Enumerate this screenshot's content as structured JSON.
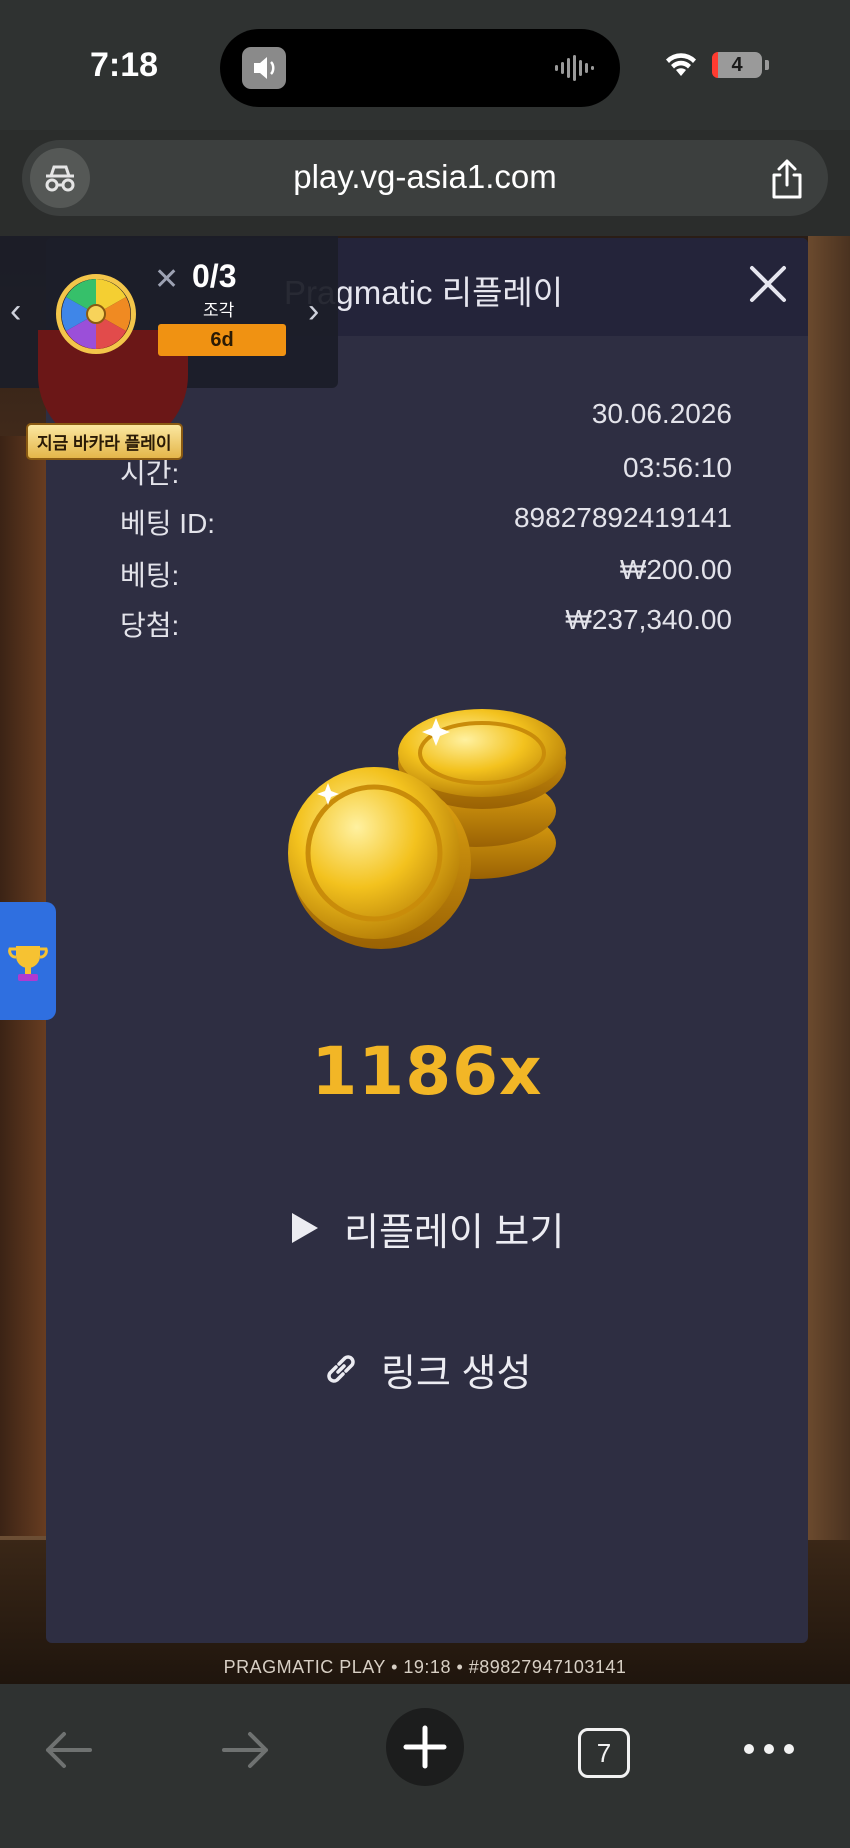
{
  "status_bar": {
    "time": "7:18",
    "battery": "4"
  },
  "browser": {
    "url": "play.vg-asia1.com",
    "tab_count": "7"
  },
  "promo": {
    "count": "0/3",
    "unit": "조각",
    "days_badge": "6d",
    "cta": "지금 바카라 플레이"
  },
  "modal": {
    "title": "Pragmatic 리플레이",
    "date_value": "30.06.2026",
    "time_label": "시간:",
    "time_value": "03:56:10",
    "bet_id_label": "베팅 ID:",
    "bet_id_value": "89827892419141",
    "bet_label": "베팅:",
    "bet_value": "₩200.00",
    "win_label": "당첨:",
    "win_value": "₩237,340.00",
    "multiplier": "1186x",
    "replay_label": "리플레이 보기",
    "link_label": "링크 생성"
  },
  "game_footer": "PRAGMATIC PLAY • 19:18 • #89827947103141",
  "colors": {
    "modal_bg": "#2e2e42",
    "accent_gold": "#f2b626",
    "promo_badge": "#f09212",
    "trophy_tab": "#2f6fe0"
  }
}
